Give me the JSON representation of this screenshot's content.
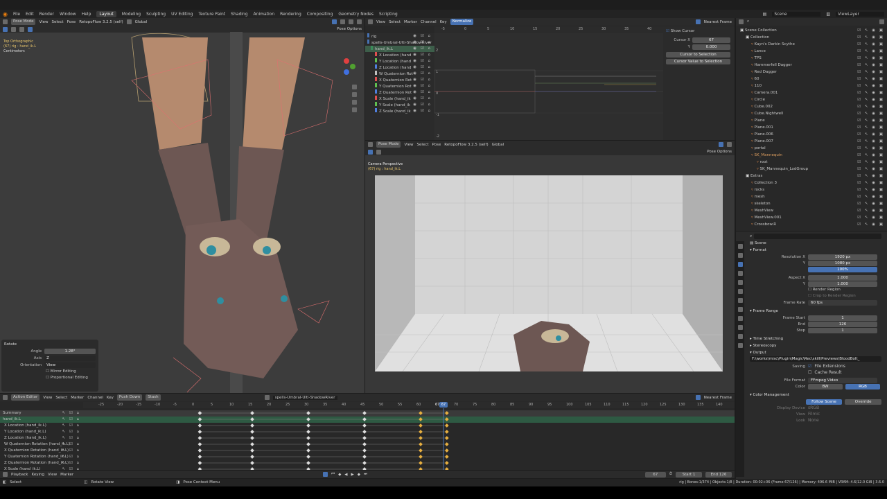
{
  "topbar": {
    "menus": [
      "File",
      "Edit",
      "Render",
      "Window",
      "Help"
    ],
    "workspaces": [
      "Layout",
      "Modeling",
      "Sculpting",
      "UV Editing",
      "Texture Paint",
      "Shading",
      "Animation",
      "Rendering",
      "Compositing",
      "Geometry Nodes",
      "Scripting"
    ],
    "active_workspace": "Layout",
    "scene": "Scene",
    "view_layer": "ViewLayer"
  },
  "viewport3d": {
    "mode": "Pose Mode",
    "menus": [
      "View",
      "Select",
      "Pose"
    ],
    "retopo": "RetopoFlow 3.2.5 (self)",
    "transform": "Global",
    "pose_options": "Pose Options",
    "overlay_text": [
      "Top Orthographic",
      "(67) rig : hand_ik.L",
      "Centimeters"
    ]
  },
  "rotate_panel": {
    "title": "Rotate",
    "angle_label": "Angle",
    "angle": "1.28°",
    "axis_label": "Axis",
    "axis": "Z",
    "orient_label": "Orientation",
    "orient": "View",
    "mirror": "Mirror Editing",
    "proportional": "Proportional Editing"
  },
  "graph": {
    "menus": [
      "View",
      "Select",
      "Marker",
      "Channel",
      "Key"
    ],
    "normalize": "Normalize",
    "pivot": "Nearest Frame",
    "frames": [
      "-5",
      "0",
      "5",
      "10",
      "15",
      "20",
      "25",
      "30",
      "35",
      "40"
    ],
    "yvals": [
      "2",
      "1",
      "0",
      "-1",
      "-2"
    ],
    "show_cursor": "Show Cursor",
    "cursor_x_label": "Cursor X",
    "cursor_x": "67",
    "cursor_y_label": "Y",
    "cursor_y": "0.000",
    "btn1": "Cursor to Selection",
    "btn2": "Cursor Value to Selection",
    "channels": [
      {
        "name": "rig",
        "color": "#4772b3"
      },
      {
        "name": "spells-Umbral-Ulti-ShadowRiver",
        "color": "#4772b3"
      },
      {
        "name": "hand_ik.L",
        "color": "#3a8c5a"
      },
      {
        "name": "X Location (hand",
        "color": "#e05050"
      },
      {
        "name": "Y Location (hand",
        "color": "#60c050"
      },
      {
        "name": "Z Location (hand",
        "color": "#5080e0"
      },
      {
        "name": "W Quaternion Rot",
        "color": "#c0c0c0"
      },
      {
        "name": "X Quaternion Rot",
        "color": "#e05050"
      },
      {
        "name": "Y Quaternion Rot",
        "color": "#60c050"
      },
      {
        "name": "Z Quaternion Rot",
        "color": "#5080e0"
      },
      {
        "name": "X Scale (hand_ik",
        "color": "#e05050"
      },
      {
        "name": "Y Scale (hand_ik",
        "color": "#60c050"
      },
      {
        "name": "Z Scale (hand_ik",
        "color": "#5080e0"
      }
    ]
  },
  "camview": {
    "mode": "Pose Mode",
    "menus": [
      "View",
      "Select",
      "Pose"
    ],
    "retopo": "RetopoFlow 3.2.5 (self)",
    "transform": "Global",
    "pose_options": "Pose Options",
    "overlay_title": "Camera Perspective",
    "overlay_sub": "(67) rig : hand_ik.L"
  },
  "outliner": {
    "items": [
      {
        "name": "Scene Collection",
        "indent": 0
      },
      {
        "name": "Collection",
        "indent": 1
      },
      {
        "name": "Kayn's Darkin Scythe",
        "indent": 2
      },
      {
        "name": "Lance",
        "indent": 2
      },
      {
        "name": "TPS",
        "indent": 2
      },
      {
        "name": "Hammerfell Dagger",
        "indent": 2
      },
      {
        "name": "Red Dagger",
        "indent": 2
      },
      {
        "name": "60",
        "indent": 2
      },
      {
        "name": "110",
        "indent": 2
      },
      {
        "name": "Camera.001",
        "indent": 2
      },
      {
        "name": "Circle",
        "indent": 2
      },
      {
        "name": "Cube.002",
        "indent": 2
      },
      {
        "name": "Cube.Nightwell",
        "indent": 2
      },
      {
        "name": "Plane",
        "indent": 2
      },
      {
        "name": "Plane.001",
        "indent": 2
      },
      {
        "name": "Plane.006",
        "indent": 2
      },
      {
        "name": "Plane.007",
        "indent": 2
      },
      {
        "name": "portal",
        "indent": 2
      },
      {
        "name": "SK_Mannequin",
        "indent": 2
      },
      {
        "name": "root",
        "indent": 3
      },
      {
        "name": "SK_Mannequin_LodGroup",
        "indent": 3
      },
      {
        "name": "Extras",
        "indent": 1
      },
      {
        "name": "Collection 3",
        "indent": 2
      },
      {
        "name": "rocks",
        "indent": 2
      },
      {
        "name": "mesh",
        "indent": 2
      },
      {
        "name": "skeleton",
        "indent": 2
      },
      {
        "name": "MeshView",
        "indent": 2
      },
      {
        "name": "MeshView.001",
        "indent": 2
      },
      {
        "name": "Crossbow.R",
        "indent": 2
      }
    ]
  },
  "properties": {
    "context": "Scene",
    "format": "Format",
    "resx_label": "Resolution X",
    "resx": "1920 px",
    "resy_label": "Y",
    "resy": "1080 px",
    "pct": "100%",
    "aspx_label": "Aspect X",
    "aspx": "1.000",
    "aspy_label": "Y",
    "aspy": "1.000",
    "render_region": "Render Region",
    "crop": "Crop to Render Region",
    "fps_label": "Frame Rate",
    "fps": "60 fps",
    "frame_range": "Frame Range",
    "fstart_label": "Frame Start",
    "fstart": "1",
    "fend_label": "End",
    "fend": "126",
    "fstep_label": "Step",
    "fstep": "1",
    "time_stretch": "Time Stretching",
    "stereo": "Stereoscopy",
    "output": "Output",
    "path": "F:\\works\\misc\\Plugin\\Magic\\Rec\\skill\\Previews\\BloodBolt_",
    "saving_label": "Saving",
    "file_ext": "File Extensions",
    "cache": "Cache Result",
    "ffmt_label": "File Format",
    "ffmt": "FFmpeg Video",
    "color_label": "Color",
    "bw": "BW",
    "rgb": "RGB",
    "color_mgmt": "Color Management",
    "follow": "Follow Scene",
    "override": "Override",
    "display_label": "Display Device",
    "display": "sRGB",
    "view_label": "View",
    "view": "Filmic",
    "look_label": "Look",
    "look": "None"
  },
  "action": {
    "editor": "Action Editor",
    "menus": [
      "View",
      "Select",
      "Marker",
      "Channel",
      "Key"
    ],
    "push": "Push Down",
    "stash": "Stash",
    "action_name": "spells-Umbral-Ulti-ShadowRiver",
    "pivot": "Nearest Frame",
    "frames": [
      "-25",
      "-20",
      "-15",
      "-10",
      "-5",
      "0",
      "5",
      "10",
      "15",
      "20",
      "25",
      "30",
      "35",
      "40",
      "45",
      "50",
      "55",
      "60",
      "67",
      "70",
      "75",
      "80",
      "85",
      "90",
      "95",
      "100",
      "105",
      "110",
      "115",
      "120",
      "125",
      "130",
      "135",
      "140"
    ],
    "current": "67",
    "rows": [
      "Summary",
      "hand_ik.L",
      "X Location (hand_ik.L)",
      "Y Location (hand_ik.L)",
      "Z Location (hand_ik.L)",
      "W Quaternion Rotation (hand_ik.L)",
      "X Quaternion Rotation (hand_ik.L)",
      "Y Quaternion Rotation (hand_ik.L)",
      "Z Quaternion Rotation (hand_ik.L)",
      "X Scale (hand_ik.L)"
    ]
  },
  "playback": {
    "menus": [
      "Playback",
      "Keying",
      "View",
      "Marker"
    ],
    "frame": "67",
    "start_label": "Start",
    "start": "1",
    "end_label": "End",
    "end": "126"
  },
  "status": {
    "left": "Select",
    "mid": "Rotate View",
    "ctx": "Pose Context Menu",
    "right": "rig | Bones:1/374 | Objects:1/8 | Duration: 00:02+06 (Frame 67/126) | Memory: 496.6 MiB | VRAM: 4.6/12.0 GiB | 3.6.0"
  }
}
